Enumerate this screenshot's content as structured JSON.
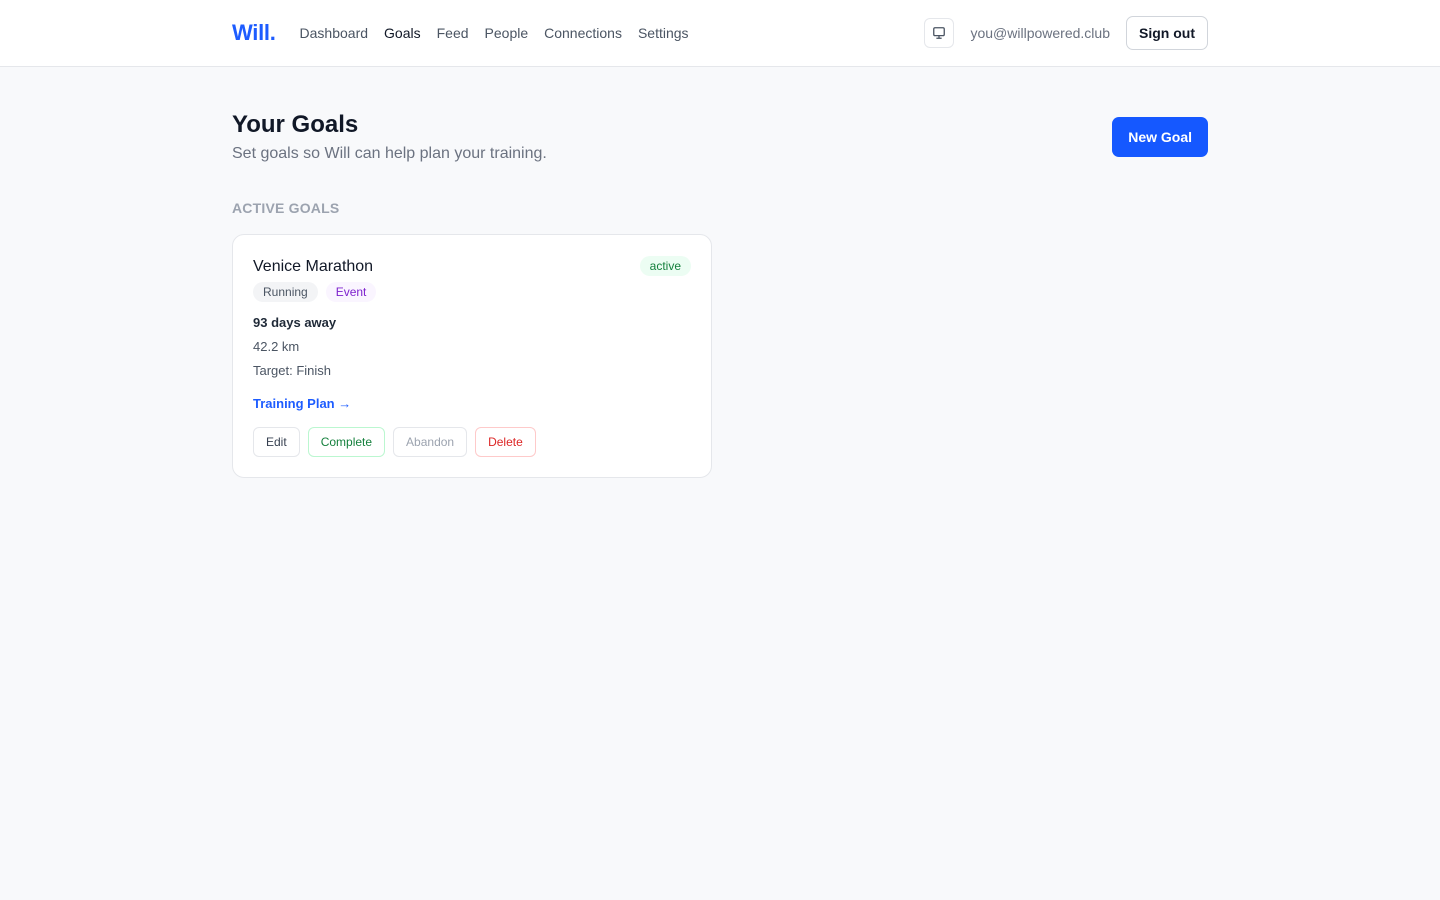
{
  "header": {
    "logo": "Will.",
    "nav": [
      {
        "label": "Dashboard",
        "active": false
      },
      {
        "label": "Goals",
        "active": true
      },
      {
        "label": "Feed",
        "active": false
      },
      {
        "label": "People",
        "active": false
      },
      {
        "label": "Connections",
        "active": false
      },
      {
        "label": "Settings",
        "active": false
      }
    ],
    "display_icon": "monitor-icon",
    "user_email": "you@willpowered.club",
    "sign_out_label": "Sign out"
  },
  "page": {
    "title": "Your Goals",
    "subtitle": "Set goals so Will can help plan your training.",
    "new_goal_label": "New Goal",
    "section_label": "ACTIVE GOALS"
  },
  "goals": [
    {
      "title": "Venice Marathon",
      "status": "active",
      "tags": [
        "Running",
        "Event"
      ],
      "days_away": "93 days away",
      "distance": "42.2 km",
      "target": "Target: Finish",
      "plan_link": "Training Plan →",
      "actions": {
        "edit": "Edit",
        "complete": "Complete",
        "abandon": "Abandon",
        "delete": "Delete"
      }
    }
  ],
  "colors": {
    "brand": "#1d5cff",
    "primary_button": "#1558ff",
    "status_active": "#15803d",
    "danger": "#dc2626"
  }
}
